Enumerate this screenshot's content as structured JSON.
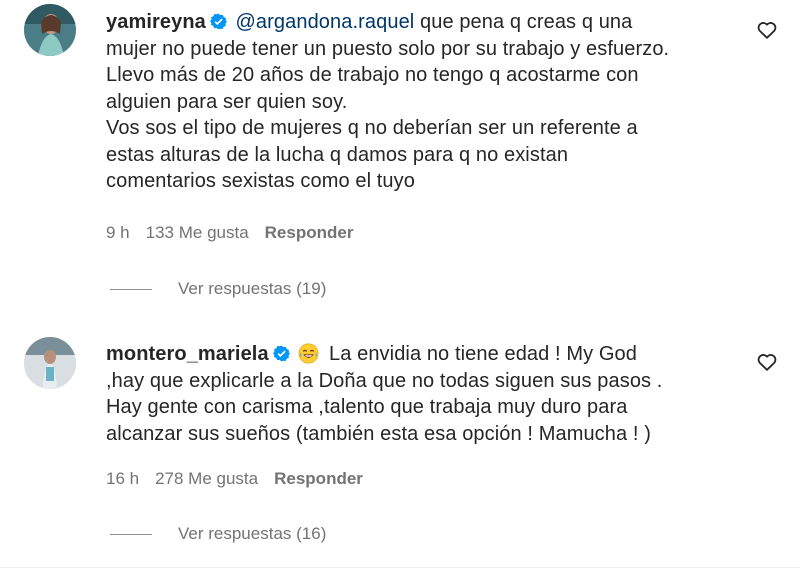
{
  "comments": [
    {
      "username": "yamireyna",
      "verified": true,
      "mention": "@argandona.raquel",
      "lines": [
        " que pena q creas q una",
        "mujer no puede tener un puesto solo por su trabajo y esfuerzo.",
        "Llevo más de 20 años de trabajo no tengo q acostarme con",
        "alguien para ser quien soy.",
        "Vos sos el tipo de mujeres q no deberían ser un referente a",
        "estas alturas de la lucha q damos para q no existan",
        "comentarios sexistas como el tuyo"
      ],
      "time": "9 h",
      "likes": "133 Me gusta",
      "reply_label": "Responder",
      "view_replies": "Ver respuestas (19)",
      "heart_icon": "heart-outline-icon"
    },
    {
      "username": "montero_mariela",
      "verified": true,
      "emoji": "laughing-tears-emoji",
      "lines": [
        " La envidia no tiene edad ! My God",
        ",hay que explicarle a la Doña que no todas siguen sus pasos .",
        "Hay gente con carisma ,talento que trabaja muy duro para",
        "alcanzar sus sueños (también esta esa opción ! Mamucha ! )"
      ],
      "time": "16 h",
      "likes": "278 Me gusta",
      "reply_label": "Responder",
      "view_replies": "Ver respuestas (16)",
      "heart_icon": "heart-outline-icon"
    }
  ],
  "colors": {
    "text": "#262626",
    "meta": "#737373",
    "mention": "#00376b",
    "verified": "#0095f6"
  }
}
